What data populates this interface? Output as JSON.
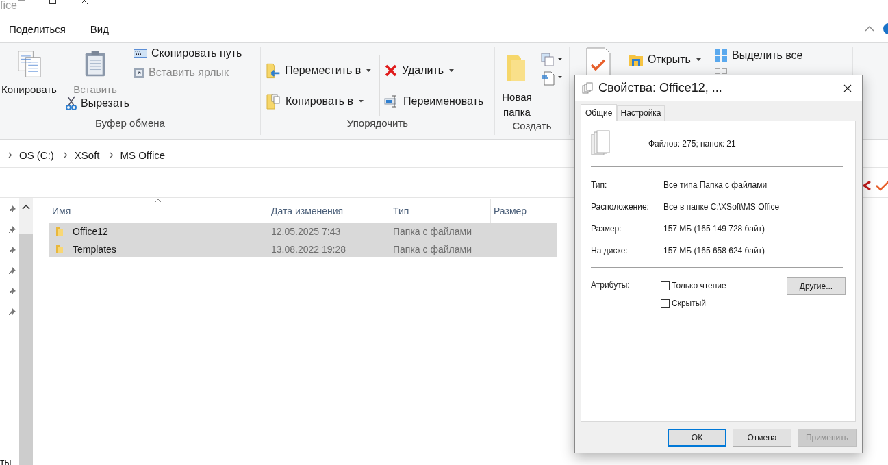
{
  "window": {
    "title": "fice"
  },
  "ribbon_tabs": [
    {
      "label": "Поделиться"
    },
    {
      "label": "Вид"
    }
  ],
  "ribbon": {
    "clipboard": {
      "label": "Буфер обмена",
      "large": [
        {
          "kind": "copy",
          "label": "Копировать",
          "disabled": false
        },
        {
          "kind": "paste",
          "label": "Вставить",
          "disabled": true
        }
      ],
      "small": [
        {
          "kind": "copy_path",
          "label": "Скопировать путь",
          "disabled": false
        },
        {
          "kind": "paste_shortcut",
          "label": "Вставить ярлык",
          "disabled": true
        }
      ],
      "cut": {
        "label": "Вырезать",
        "disabled": false
      }
    },
    "organize": {
      "label": "Упорядочить",
      "items": [
        {
          "kind": "move",
          "label": "Переместить в",
          "has_menu": true
        },
        {
          "kind": "copy_to",
          "label": "Копировать в",
          "has_menu": true
        },
        {
          "kind": "delete",
          "label": "Удалить",
          "has_menu": true
        },
        {
          "kind": "rename",
          "label": "Переименовать",
          "has_menu": false
        }
      ]
    },
    "create": {
      "label": "Создать",
      "new_folder": "Новая папка"
    },
    "open": {
      "label": "Открыть",
      "has_menu": true
    },
    "select": {
      "items": [
        {
          "kind": "select_all",
          "label": "Выделить все"
        },
        {
          "kind": "select_none"
        }
      ]
    }
  },
  "breadcrumbs": [
    "OS (C:)",
    "XSoft",
    "MS Office"
  ],
  "nav_footer": "ты",
  "table": {
    "columns": [
      "Имя",
      "Дата изменения",
      "Тип",
      "Размер"
    ],
    "rows": [
      {
        "name": "Office12",
        "modified": "12.05.2025 7:43",
        "type": "Папка с файлами",
        "selected": true
      },
      {
        "name": "Templates",
        "modified": "13.08.2022 19:28",
        "type": "Папка с файлами",
        "selected": true
      }
    ]
  },
  "dialog": {
    "title": "Свойства: Office12, ...",
    "tabs": [
      {
        "label": "Общие",
        "selected": true
      },
      {
        "label": "Настройка",
        "selected": false
      }
    ],
    "summary": "Файлов: 275; папок: 21",
    "groups": [
      [
        {
          "label": "Тип:",
          "value": "Все типа Папка с файлами"
        },
        {
          "label": "Расположение:",
          "value": "Все в папке C:\\XSoft\\MS Office"
        },
        {
          "label": "Размер:",
          "value": "157 МБ (165 149 728 байт)"
        },
        {
          "label": "На диске:",
          "value": "157 МБ (165 658 624 байт)"
        }
      ]
    ],
    "attributes_label": "Атрибуты:",
    "attributes": [
      {
        "label": "Только чтение",
        "checked": false
      },
      {
        "label": "Скрытый",
        "checked": false
      }
    ],
    "advanced_button": "Другие...",
    "buttons": [
      {
        "label": "ОК",
        "default": true,
        "disabled": false
      },
      {
        "label": "Отмена",
        "default": false,
        "disabled": false
      },
      {
        "label": "Применить",
        "default": false,
        "disabled": true
      }
    ]
  }
}
